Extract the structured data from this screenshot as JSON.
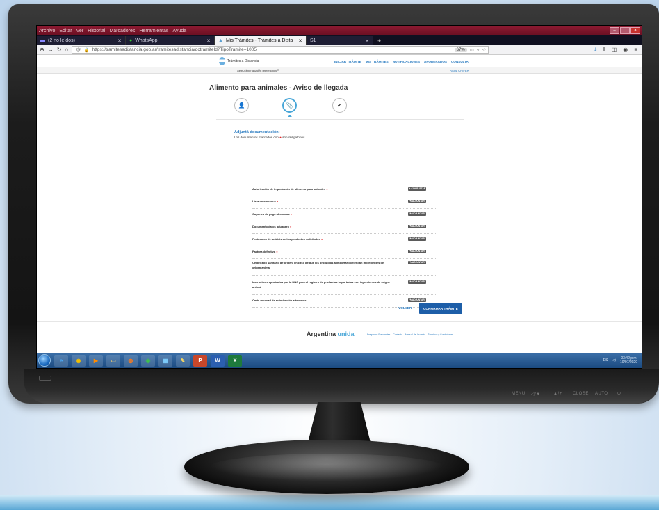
{
  "browser": {
    "menu": [
      "Archivo",
      "Editar",
      "Ver",
      "Historial",
      "Marcadores",
      "Herramientas",
      "Ayuda"
    ],
    "tabs": [
      {
        "label": "(2 no leídos)"
      },
      {
        "label": "WhatsApp"
      },
      {
        "label": "Mis Trámites - Trámites a Dista",
        "active": true
      },
      {
        "label": "S1"
      }
    ],
    "url": "https://tramitesadistancia.gob.ar/tramitesadistancia/dctramiteId?TipoTramite=1005",
    "zoom": "67%",
    "accent": "#8e1a32"
  },
  "site": {
    "logo_label": "Trámites a Distancia",
    "nav": [
      "INICIAR TRÁMITE",
      "MIS TRÁMITES",
      "NOTIFICACIONES",
      "APODERADOS",
      "CONSULTA"
    ],
    "selector_label": "Seleccione a quién representar",
    "user_label": "RAUL CHIFER"
  },
  "page": {
    "title": "Alimento para animales - Aviso de llegada",
    "section_title": "Adjuntá documentación:",
    "note": "Los documentos marcados con",
    "note_tail": "son obligatorios.",
    "documents": [
      {
        "label": "Autorización de importación de alimento para animales",
        "required": true,
        "button": "✎ COMPLETAR"
      },
      {
        "label": "Lista de empaque",
        "required": true,
        "button": "✎ ADJUNTAR"
      },
      {
        "label": "Cupones de pago abonados",
        "required": true,
        "button": "✎ ADJUNTAR"
      },
      {
        "label": "Documento datos aduanero",
        "required": true,
        "button": "✎ ADJUNTAR"
      },
      {
        "label": "Protocolos de análisis de los productos solicitados",
        "required": true,
        "button": "✎ ADJUNTAR"
      },
      {
        "label": "Factura definitiva",
        "required": true,
        "button": "✎ ADJUNTAR"
      },
      {
        "label": "Certificado sanitario de origen, en caso de que los productos a importar contengan ingredientes de origen animal",
        "required": false,
        "button": "✎ ADJUNTAR"
      },
      {
        "label": "Instructivos aprobados por la DNC para el registro de productos importados con ingredientes de origen animal",
        "required": false,
        "button": "✎ ADJUNTAR"
      },
      {
        "label": "Carta renovad de autorización a terceros",
        "required": false,
        "button": "✎ ADJUNTAR"
      }
    ],
    "back_label": "VOLVER",
    "confirm_label": "CONFIRMAR TRÁMITE"
  },
  "footer": {
    "brand_a": "Argentina",
    "brand_b": "unida",
    "links": [
      "Preguntas Frecuentes",
      "Contacto",
      "Manual de Usuario",
      "Términos y Condiciones"
    ]
  },
  "monitor": {
    "controls": [
      "MENU",
      "◁/▼",
      "▲/+",
      "CLOSE",
      "AUTO",
      "⏻"
    ]
  },
  "taskbar": {
    "lang": "ES",
    "time": "03:42 p.m.",
    "date": "10/07/2020"
  }
}
